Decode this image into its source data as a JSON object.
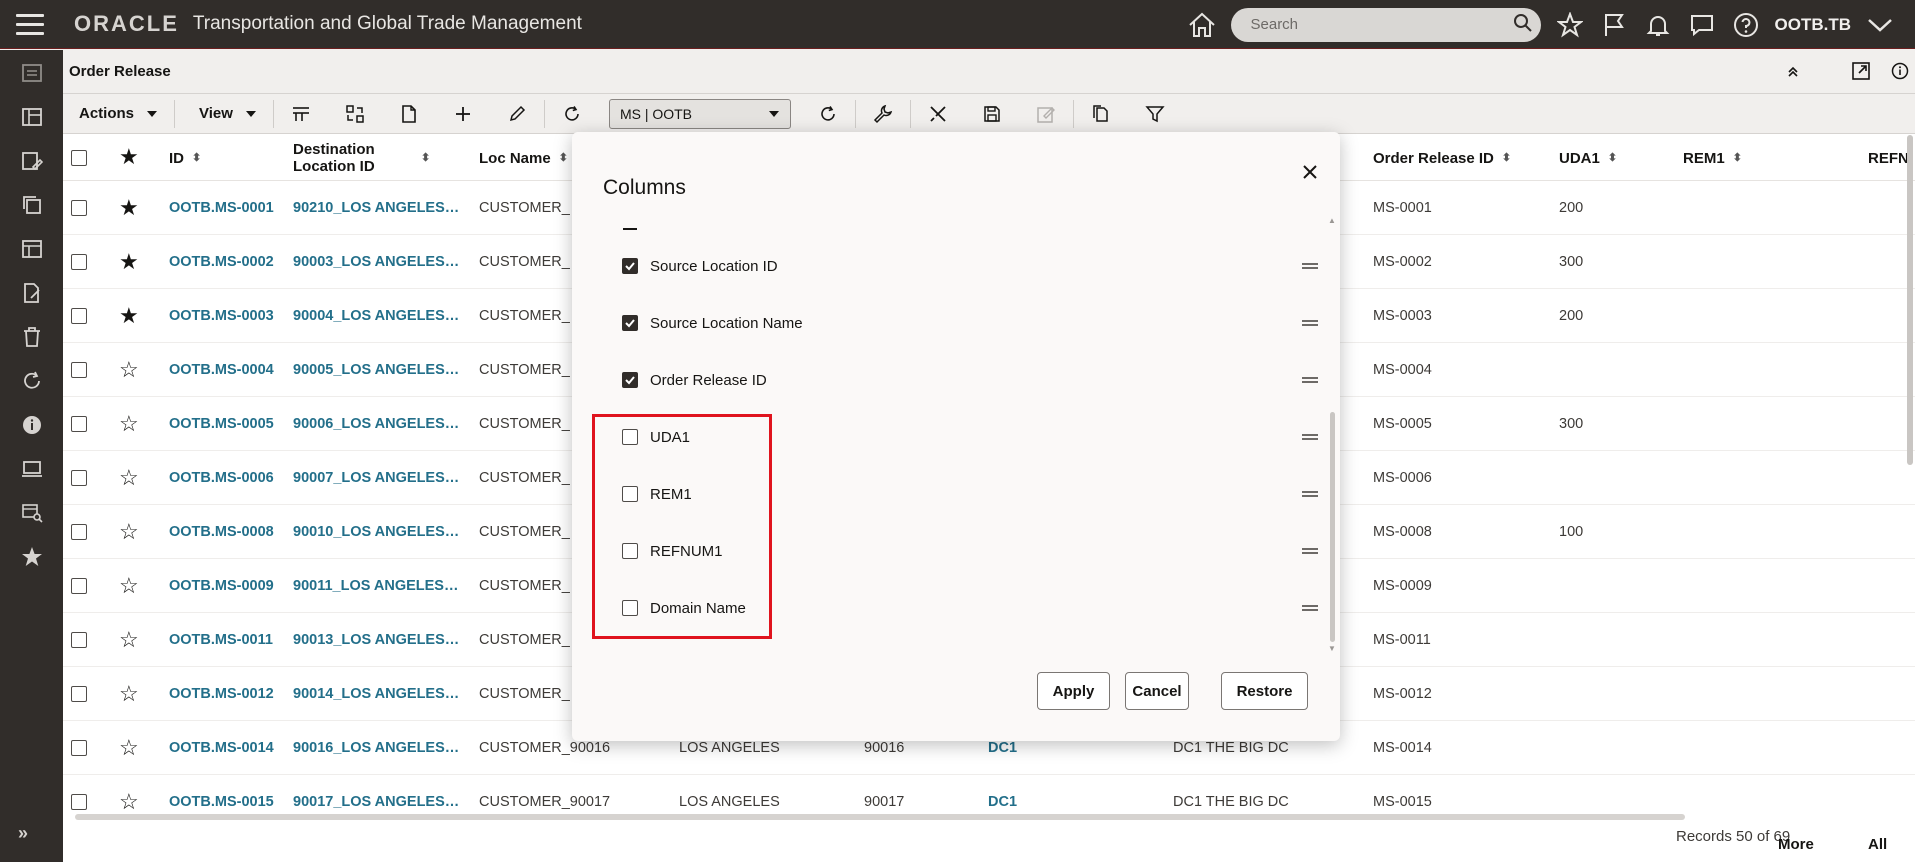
{
  "header": {
    "brand": "ORACLE",
    "app_title": "Transportation and Global Trade Management",
    "search_placeholder": "Search",
    "user": "OOTB.TB"
  },
  "page": {
    "title": "Order Release",
    "toolbar": {
      "actions_label": "Actions",
      "view_label": "View",
      "saved_query_value": "MS | OOTB"
    }
  },
  "table": {
    "columns": [
      {
        "label": "ID"
      },
      {
        "label": "Destination Location ID"
      },
      {
        "label": "Loc Name"
      },
      {
        "label": "Order Release ID"
      },
      {
        "label": "UDA1"
      },
      {
        "label": "REM1"
      },
      {
        "label": "REFN"
      }
    ],
    "rows": [
      {
        "starred": true,
        "id": "OOTB.MS-0001",
        "dest": "90210_LOS ANGELES…",
        "loc": "CUSTOMER_",
        "city": "",
        "zip": "",
        "dc": "",
        "dc_name": "",
        "orid": "MS-0001",
        "uda1": "200"
      },
      {
        "starred": true,
        "id": "OOTB.MS-0002",
        "dest": "90003_LOS ANGELES…",
        "loc": "CUSTOMER_",
        "city": "",
        "zip": "",
        "dc": "",
        "dc_name": "",
        "orid": "MS-0002",
        "uda1": "300"
      },
      {
        "starred": true,
        "id": "OOTB.MS-0003",
        "dest": "90004_LOS ANGELES…",
        "loc": "CUSTOMER_",
        "city": "",
        "zip": "",
        "dc": "",
        "dc_name": "",
        "orid": "MS-0003",
        "uda1": "200"
      },
      {
        "starred": false,
        "id": "OOTB.MS-0004",
        "dest": "90005_LOS ANGELES…",
        "loc": "CUSTOMER_",
        "city": "",
        "zip": "",
        "dc": "",
        "dc_name": "",
        "orid": "MS-0004",
        "uda1": ""
      },
      {
        "starred": false,
        "id": "OOTB.MS-0005",
        "dest": "90006_LOS ANGELES…",
        "loc": "CUSTOMER_",
        "city": "",
        "zip": "",
        "dc": "",
        "dc_name": "",
        "orid": "MS-0005",
        "uda1": "300"
      },
      {
        "starred": false,
        "id": "OOTB.MS-0006",
        "dest": "90007_LOS ANGELES…",
        "loc": "CUSTOMER_",
        "city": "",
        "zip": "",
        "dc": "",
        "dc_name": "",
        "orid": "MS-0006",
        "uda1": ""
      },
      {
        "starred": false,
        "id": "OOTB.MS-0008",
        "dest": "90010_LOS ANGELES…",
        "loc": "CUSTOMER_",
        "city": "",
        "zip": "",
        "dc": "",
        "dc_name": "",
        "orid": "MS-0008",
        "uda1": "100"
      },
      {
        "starred": false,
        "id": "OOTB.MS-0009",
        "dest": "90011_LOS ANGELES…",
        "loc": "CUSTOMER_",
        "city": "",
        "zip": "",
        "dc": "",
        "dc_name": "",
        "orid": "MS-0009",
        "uda1": ""
      },
      {
        "starred": false,
        "id": "OOTB.MS-0011",
        "dest": "90013_LOS ANGELES…",
        "loc": "CUSTOMER_",
        "city": "",
        "zip": "",
        "dc": "",
        "dc_name": "",
        "orid": "MS-0011",
        "uda1": ""
      },
      {
        "starred": false,
        "id": "OOTB.MS-0012",
        "dest": "90014_LOS ANGELES…",
        "loc": "CUSTOMER_",
        "city": "",
        "zip": "",
        "dc": "",
        "dc_name": "",
        "orid": "MS-0012",
        "uda1": ""
      },
      {
        "starred": false,
        "id": "OOTB.MS-0014",
        "dest": "90016_LOS ANGELES…",
        "loc": "CUSTOMER_90016",
        "city": "LOS ANGELES",
        "zip": "90016",
        "dc": "DC1",
        "dc_name": "DC1 THE BIG DC",
        "orid": "MS-0014",
        "uda1": ""
      },
      {
        "starred": false,
        "id": "OOTB.MS-0015",
        "dest": "90017_LOS ANGELES…",
        "loc": "CUSTOMER_90017",
        "city": "LOS ANGELES",
        "zip": "90017",
        "dc": "DC1",
        "dc_name": "DC1 THE BIG DC",
        "orid": "MS-0015",
        "uda1": ""
      }
    ]
  },
  "footer": {
    "records": "Records 50 of 69",
    "more": "More",
    "all": "All"
  },
  "modal": {
    "title": "Columns",
    "items": [
      {
        "label": "Source Location ID",
        "checked": true
      },
      {
        "label": "Source Location Name",
        "checked": true
      },
      {
        "label": "Order Release ID",
        "checked": true
      },
      {
        "label": "UDA1",
        "checked": false
      },
      {
        "label": "REM1",
        "checked": false
      },
      {
        "label": "REFNUM1",
        "checked": false
      },
      {
        "label": "Domain Name",
        "checked": false
      }
    ],
    "apply": "Apply",
    "cancel": "Cancel",
    "restore": "Restore"
  },
  "colors": {
    "header_bg": "#312d2a",
    "link": "#236f8a",
    "highlight": "#e0141e"
  }
}
